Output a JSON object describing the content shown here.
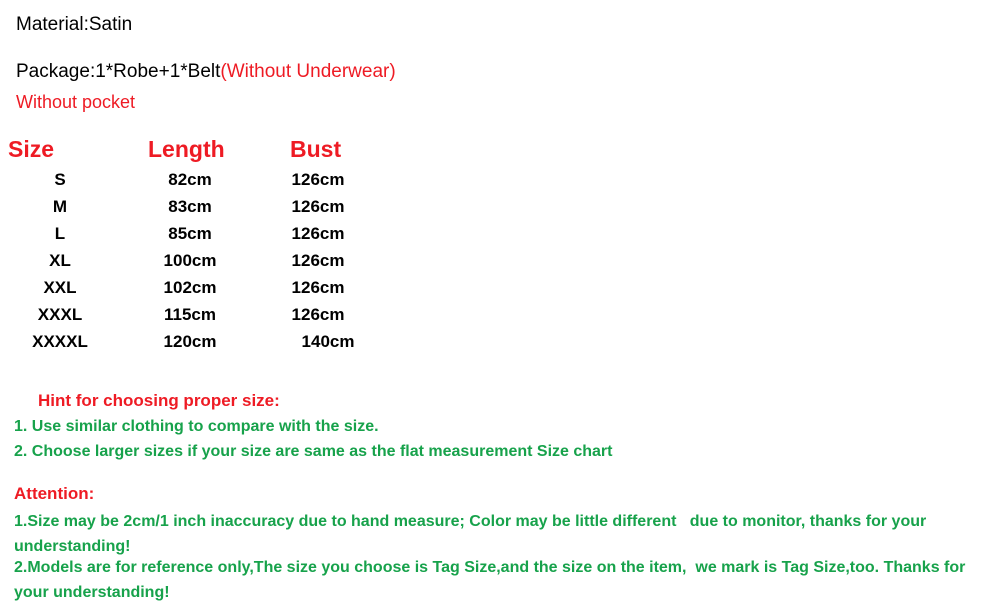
{
  "colors": {
    "red": "#ee1b24",
    "green": "#17a24b",
    "black": "#000000",
    "background": "#ffffff"
  },
  "description": {
    "material": "Material:Satin",
    "package_black": "Package:1*Robe+1*Belt",
    "package_red": "(Without Underwear)",
    "pocket_note": "Without pocket"
  },
  "size_chart": {
    "headers": [
      "Size",
      "Length",
      "Bust"
    ],
    "rows": [
      {
        "size": "S",
        "length": "82cm",
        "bust": "126cm"
      },
      {
        "size": "M",
        "length": "83cm",
        "bust": "126cm"
      },
      {
        "size": "L",
        "length": "85cm",
        "bust": "126cm"
      },
      {
        "size": "XL",
        "length": "100cm",
        "bust": "126cm"
      },
      {
        "size": "XXL",
        "length": "102cm",
        "bust": "126cm"
      },
      {
        "size": "XXXL",
        "length": "115cm",
        "bust": "126cm"
      },
      {
        "size": "XXXXL",
        "length": "120cm",
        "bust": "140cm"
      }
    ]
  },
  "hint": {
    "title": "Hint for choosing proper size:",
    "items": [
      "1. Use similar clothing to compare with the size.",
      "2. Choose larger sizes if your size are same as the flat measurement Size chart"
    ]
  },
  "attention": {
    "title": "Attention:",
    "items": [
      "1.Size may be 2cm/1 inch inaccuracy due to hand measure; Color may be little different   due to monitor, thanks for your understanding!",
      "2.Models are for reference only,The size you choose is Tag Size,and the size on the item,  we mark is Tag Size,too. Thanks for your understanding!"
    ]
  }
}
